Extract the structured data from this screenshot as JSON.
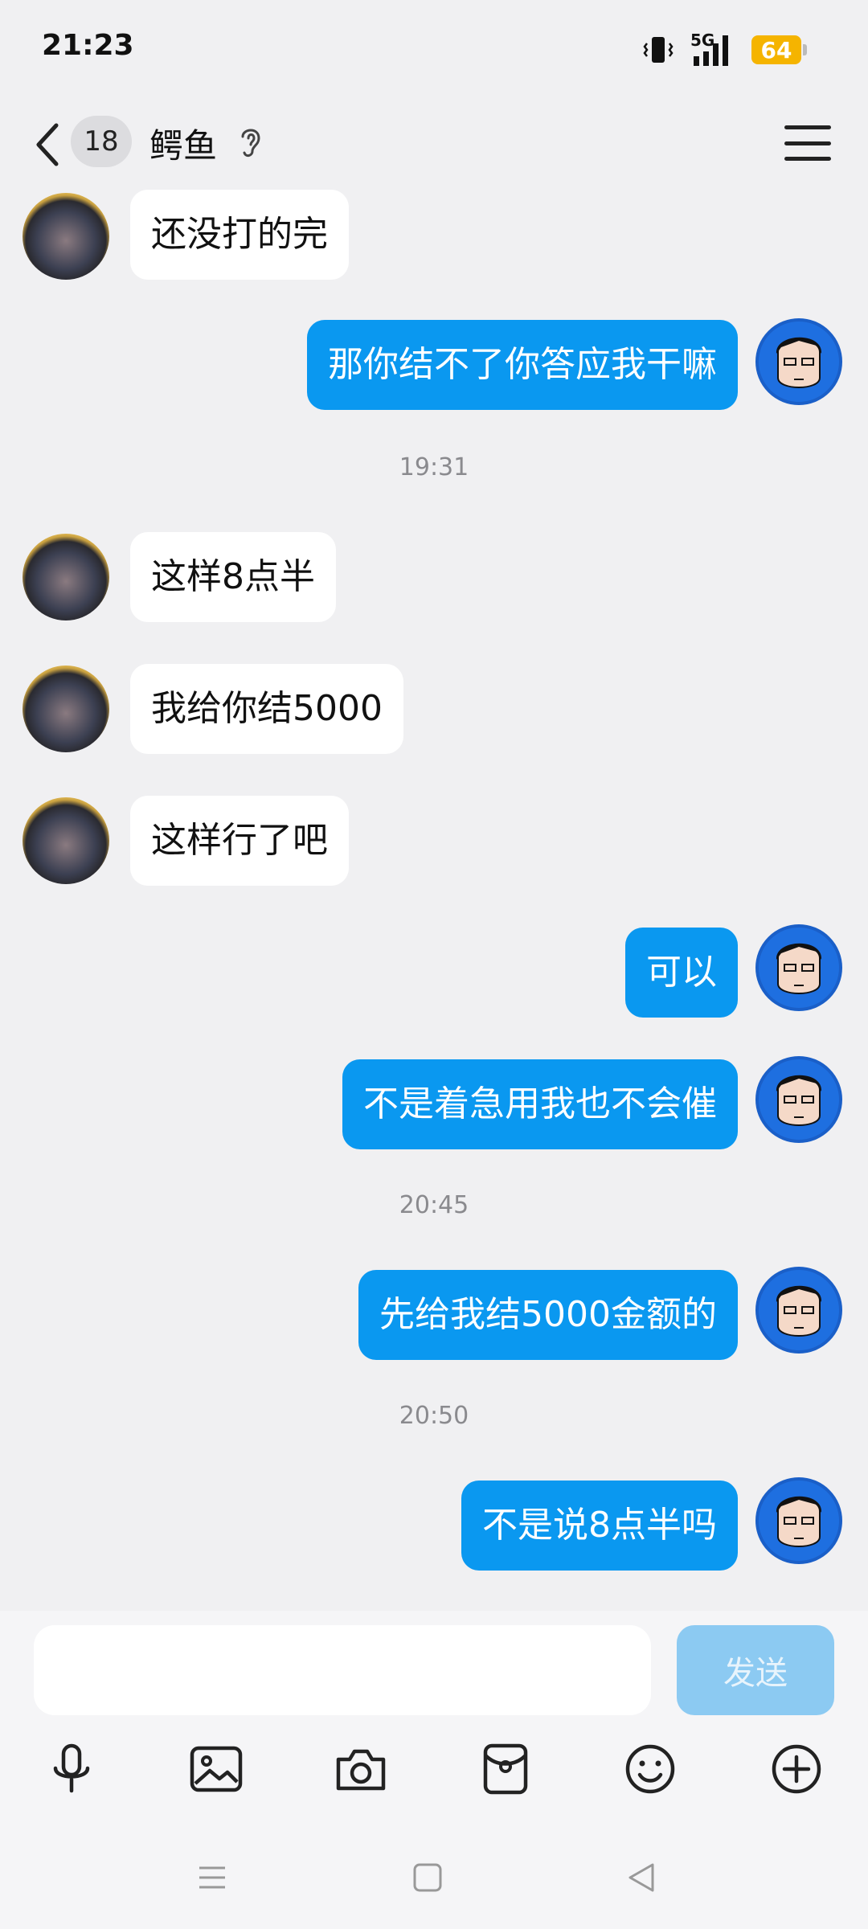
{
  "status_bar": {
    "time": "21:23",
    "network": "5G",
    "battery": "64"
  },
  "header": {
    "unread_count": "18",
    "contact_name": "鳄鱼",
    "back_icon": "chevron-left-icon",
    "mode_icon": "ear-icon",
    "menu_icon": "hamburger-menu-icon"
  },
  "messages": [
    {
      "side": "in",
      "text": "还没打的完"
    },
    {
      "side": "out",
      "text": "那你结不了你答应我干嘛"
    },
    {
      "type": "time",
      "text": "19:31"
    },
    {
      "side": "in",
      "text": "这样8点半"
    },
    {
      "side": "in",
      "text": "我给你结5000"
    },
    {
      "side": "in",
      "text": "这样行了吧"
    },
    {
      "side": "out",
      "text": "可以"
    },
    {
      "side": "out",
      "text": "不是着急用我也不会催"
    },
    {
      "type": "time",
      "text": "20:45"
    },
    {
      "side": "out",
      "text": "先给我结5000金额的"
    },
    {
      "type": "time",
      "text": "20:50"
    },
    {
      "side": "out",
      "text": "不是说8点半吗"
    }
  ],
  "input_bar": {
    "placeholder": "",
    "send_label": "发送"
  },
  "toolbar": [
    "microphone-icon",
    "image-icon",
    "camera-icon",
    "red-packet-icon",
    "emoji-icon",
    "plus-icon"
  ],
  "colors": {
    "background": "#f0f0f2",
    "outgoing_bubble": "#0a98f0",
    "incoming_bubble": "#ffffff",
    "send_button_disabled": "#8ccaf2",
    "battery": "#f5b400"
  }
}
